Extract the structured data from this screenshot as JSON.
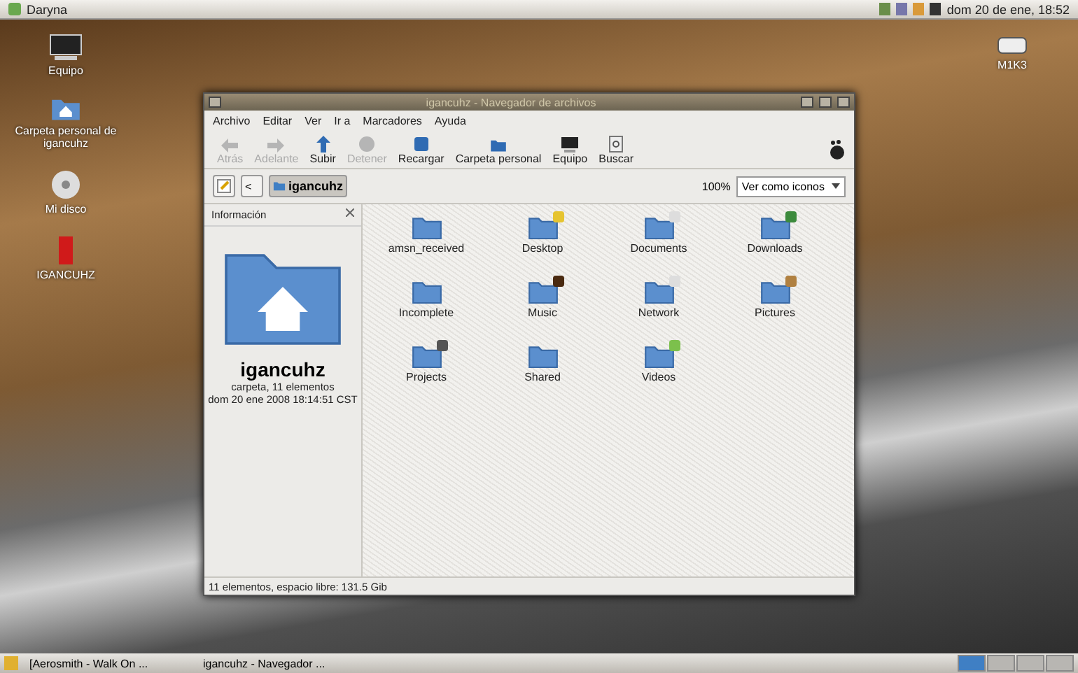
{
  "top_panel": {
    "user": "Daryna",
    "clock": "dom 20 de ene, 18:52"
  },
  "desktop_icons": [
    {
      "kind": "computer",
      "label": "Equipo"
    },
    {
      "kind": "home",
      "label": "Carpeta personal de igancuhz"
    },
    {
      "kind": "disc",
      "label": "Mi disco"
    },
    {
      "kind": "usb",
      "label": "IGANCUHZ"
    }
  ],
  "desktop_icons_right": [
    {
      "kind": "drive",
      "label": "M1K3"
    }
  ],
  "window": {
    "title": "igancuhz - Navegador de archivos",
    "menu": [
      "Archivo",
      "Editar",
      "Ver",
      "Ir a",
      "Marcadores",
      "Ayuda"
    ],
    "toolbar": [
      {
        "kind": "back",
        "label": "Atrás",
        "disabled": true
      },
      {
        "kind": "forward",
        "label": "Adelante",
        "disabled": true
      },
      {
        "kind": "up",
        "label": "Subir",
        "disabled": false
      },
      {
        "kind": "stop",
        "label": "Detener",
        "disabled": true
      },
      {
        "kind": "reload",
        "label": "Recargar",
        "disabled": false
      },
      {
        "kind": "home",
        "label": "Carpeta personal",
        "disabled": false
      },
      {
        "kind": "computer",
        "label": "Equipo",
        "disabled": false
      },
      {
        "kind": "search",
        "label": "Buscar",
        "disabled": false
      }
    ],
    "location": {
      "back_glyph": "<",
      "path": "igancuhz",
      "zoom": "100%",
      "view": "Ver como iconos"
    },
    "sidebar": {
      "title": "Información",
      "name": "igancuhz",
      "kind_line": "carpeta, 11 elementos",
      "date": "dom 20 ene 2008 18:14:51 CST"
    },
    "files": [
      {
        "name": "amsn_received",
        "kind": "plain"
      },
      {
        "name": "Desktop",
        "kind": "desktop"
      },
      {
        "name": "Documents",
        "kind": "documents"
      },
      {
        "name": "Downloads",
        "kind": "web"
      },
      {
        "name": "Incomplete",
        "kind": "plain"
      },
      {
        "name": "Music",
        "kind": "music"
      },
      {
        "name": "Network",
        "kind": "documents"
      },
      {
        "name": "Pictures",
        "kind": "pictures"
      },
      {
        "name": "Projects",
        "kind": "projects"
      },
      {
        "name": "Shared",
        "kind": "plain"
      },
      {
        "name": "Videos",
        "kind": "videos"
      }
    ],
    "status": "11 elementos, espacio libre: 131.5 Gib"
  },
  "taskbar": {
    "tasks": [
      {
        "label": "[Aerosmith - Walk On ...",
        "selected": false
      },
      {
        "label": "igancuhz - Navegador ...",
        "selected": false
      }
    ],
    "workspaces": [
      {
        "selected": true
      },
      {
        "selected": false
      },
      {
        "selected": false
      },
      {
        "selected": false
      }
    ]
  }
}
